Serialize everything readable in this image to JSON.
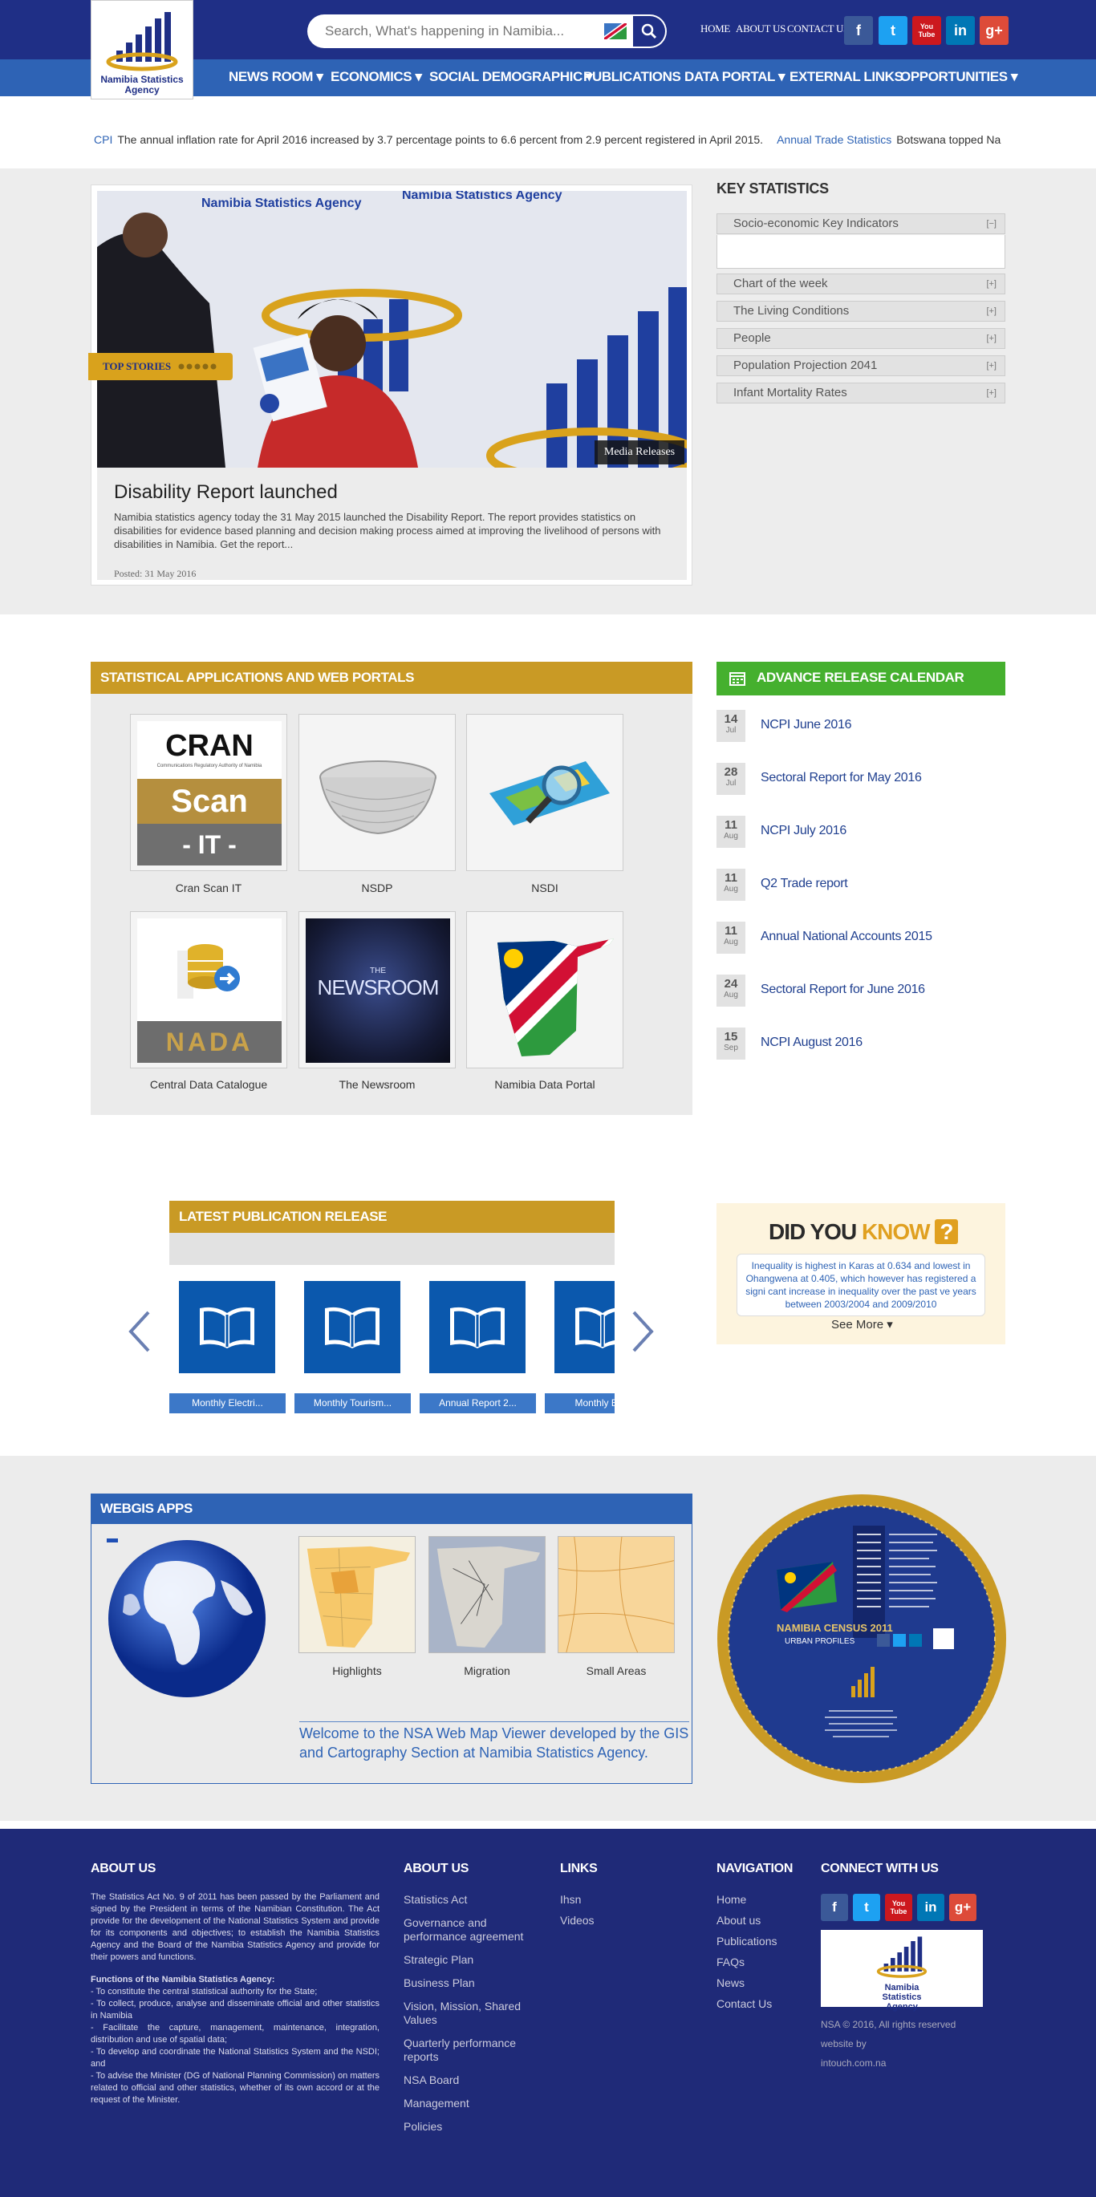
{
  "header": {
    "logo_text": "Namibia Statistics Agency",
    "search_placeholder": "Search, What's happening in Namibia...",
    "top_links": [
      "HOME",
      "ABOUT US",
      "CONTACT US"
    ],
    "social": [
      "f",
      "t",
      "You Tube",
      "in",
      "g+"
    ]
  },
  "nav": {
    "items": [
      "NEWS ROOM ▾",
      "ECONOMICS ▾",
      "SOCIAL DEMOGRAPHIC ▾",
      "PUBLICATIONS",
      "DATA PORTAL ▾",
      "EXTERNAL LINKS",
      "OPPORTUNITIES ▾"
    ]
  },
  "ticker": {
    "items": [
      {
        "key": "CPI",
        "text": "The annual inflation rate for April 2016 increased by 3.7 percentage points to 6.6 percent from 2.9 percent registered in April 2015."
      },
      {
        "key": "Annual Trade Statistics",
        "text": "Botswana topped Na"
      }
    ]
  },
  "hero": {
    "badge": "TOP STORIES",
    "category": "Media Releases",
    "title": "Disability Report launched",
    "excerpt": "Namibia statistics agency today the 31 May 2015 launched the Disability Report. The report provides statistics on disabilities for evidence based planning and decision making process aimed at improving the livelihood of persons with disabilities in Namibia. Get the report...",
    "posted": "Posted: 31 May 2016",
    "banner_text": "Namibia Statistics Agency"
  },
  "key_stats": {
    "title": "KEY STATISTICS",
    "items": [
      {
        "label": "Socio-economic Key Indicators",
        "toggle": "[−]"
      },
      {
        "label": "Chart of the week",
        "toggle": "[+]"
      },
      {
        "label": "The Living Conditions",
        "toggle": "[+]"
      },
      {
        "label": "People",
        "toggle": "[+]"
      },
      {
        "label": "Population Projection 2041",
        "toggle": "[+]"
      },
      {
        "label": "Infant Mortality Rates",
        "toggle": "[+]"
      }
    ]
  },
  "apps": {
    "title": "STATISTICAL APPLICATIONS AND WEB PORTALS",
    "tiles": [
      "Cran Scan IT",
      "NSDP",
      "NSDI",
      "Central Data Catalogue",
      "The Newsroom",
      "Namibia Data Portal"
    ],
    "cran_text": [
      "CRAN",
      "Scan",
      "- IT -"
    ],
    "cran_sub": "Communications Regulatory Authority of Namibia",
    "nada_text": "NADA",
    "newsroom_text": [
      "THE",
      "NEWSROOM"
    ]
  },
  "calendar": {
    "title": "ADVANCE RELEASE CALENDAR",
    "items": [
      {
        "day": "14",
        "mon": "Jul",
        "title": "NCPI June 2016"
      },
      {
        "day": "28",
        "mon": "Jul",
        "title": "Sectoral Report for May 2016"
      },
      {
        "day": "11",
        "mon": "Aug",
        "title": "NCPI July 2016"
      },
      {
        "day": "11",
        "mon": "Aug",
        "title": "Q2 Trade report"
      },
      {
        "day": "11",
        "mon": "Aug",
        "title": "Annual National Accounts 2015"
      },
      {
        "day": "24",
        "mon": "Aug",
        "title": "Sectoral Report for June 2016"
      },
      {
        "day": "15",
        "mon": "Sep",
        "title": "NCPI August 2016"
      }
    ]
  },
  "publications": {
    "title": "LATEST PUBLICATION RELEASE",
    "items": [
      "Monthly Electri...",
      "Monthly Tourism...",
      "Annual Report 2...",
      "Monthly Bu..."
    ]
  },
  "did_you_know": {
    "title_a": "DID YOU",
    "title_b": "KNOW",
    "mark": "?",
    "text": "Inequality is highest in Karas at 0.634 and lowest in Ohangwena at 0.405, which however has registered a signi cant increase in inequality over the past ve years between 2003/2004 and 2009/2010",
    "more": "See More ▾"
  },
  "webgis": {
    "title": "WEBGIS APPS",
    "tiles": [
      "Highlights",
      "Migration",
      "Small Areas"
    ],
    "welcome": "Welcome to the NSA Web Map Viewer developed by the GIS and Cartography Section at Namibia Statistics Agency."
  },
  "census": {
    "title": "NAMIBIA CENSUS 2011",
    "sub": "URBAN PROFILES"
  },
  "footer": {
    "about_title": "ABOUT US",
    "about_text": "The Statistics Act No. 9 of 2011 has been passed by the Parliament and signed by the President in terms of the Namibian Constitution. The Act provide for the development of the National Statistics System and provide for its components and objectives; to establish the Namibia Statistics Agency and the Board of the Namibia Statistics Agency and provide for their powers and functions.",
    "functions_title": "Functions of the Namibia Statistics Agency:",
    "functions": [
      "- To constitute the central statistical authority for the State;",
      "- To collect, produce, analyse and disseminate official and other statistics in Namibia",
      "- Facilitate the capture, management, maintenance, integration, distribution and use of spatial data;",
      "- To develop and coordinate the National Statistics System and the NSDI; and",
      "- To advise the Minister (DG of National Planning Commission) on matters related to official and other statistics, whether of its own accord or at the request of the Minister."
    ],
    "about2_title": "ABOUT US",
    "about2_links": [
      "Statistics Act",
      "Governance and performance agreement",
      "Strategic Plan",
      "Business Plan",
      "Vision, Mission, Shared Values",
      "Quarterly performance reports",
      "NSA Board",
      "Management",
      "Policies"
    ],
    "links_title": "LINKS",
    "links": [
      "Ihsn",
      "Videos"
    ],
    "nav_title": "NAVIGATION",
    "nav_links": [
      "Home",
      "About us",
      "Publications",
      "FAQs",
      "News",
      "Contact Us"
    ],
    "connect_title": "CONNECT WITH US",
    "social": [
      "f",
      "t",
      "You Tube",
      "in",
      "g+"
    ],
    "logo_text": "Namibia Statistics Agency",
    "copyright": "NSA © 2016, All rights reserved",
    "credit1": "website by",
    "credit2": "intouch.com.na"
  }
}
